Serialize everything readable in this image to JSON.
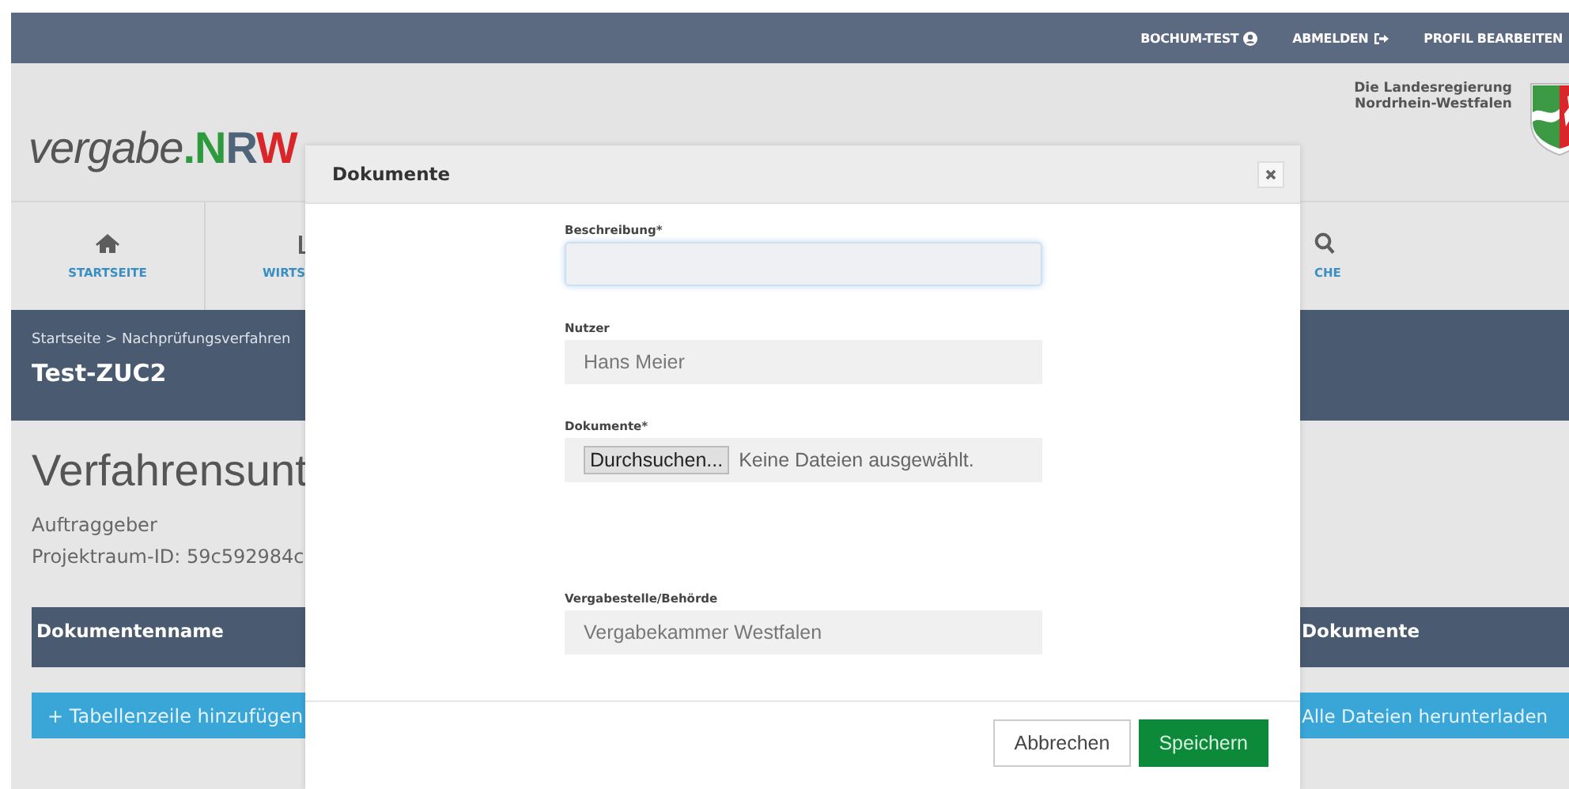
{
  "top_bar": {
    "links": [
      {
        "label": "BOCHUM-TEST"
      },
      {
        "label": "ABMELDEN"
      },
      {
        "label": "PROFIL BEARBEITEN"
      }
    ]
  },
  "header": {
    "logo": [
      "vergabe",
      ".",
      "N",
      "R",
      "W"
    ],
    "state_label": [
      "Die Landesregierung",
      "Nordrhein-Westfalen"
    ]
  },
  "nav": {
    "items": [
      {
        "label": "STARTSEITE"
      },
      {
        "label": "WIRTS"
      },
      {
        "label": "CHE"
      }
    ]
  },
  "title_band": {
    "breadcrumb": "Startseite > Nachprüfungsverfahren",
    "title": "Test-ZUC2"
  },
  "content": {
    "heading": "Verfahrensunt",
    "lines": [
      "Auftraggeber",
      "Projektraum-ID: 59c592984c"
    ],
    "table": {
      "columns": [
        "Dokumentenname",
        "Dokumente"
      ]
    },
    "buttons": [
      "+ Tabellenzeile hinzufügen",
      "Alle Dateien herunterladen"
    ]
  },
  "modal": {
    "title": "Dokumente",
    "fields": [
      {
        "kind": "text",
        "label": "Beschreibung*",
        "focused": true
      },
      {
        "kind": "text",
        "label": "Nutzer",
        "value": "Hans Meier",
        "focused": false
      },
      {
        "kind": "file",
        "label": "Dokumente*",
        "button": "Durchsuchen...",
        "status": "Keine Dateien ausgewählt.",
        "focused": false
      },
      {
        "kind": "spacer"
      },
      {
        "kind": "text",
        "label": "Vergabestelle/Behörde",
        "value": "Vergabekammer Westfalen",
        "focused": false
      }
    ],
    "buttons": [
      {
        "label": "Abbrechen",
        "kind": "default"
      },
      {
        "label": "Speichern",
        "kind": "primary"
      }
    ]
  }
}
